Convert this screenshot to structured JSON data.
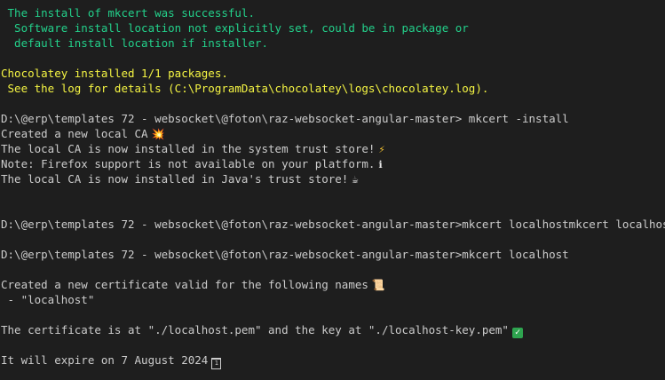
{
  "terminal": {
    "lines": [
      {
        "text": " The install of mkcert was successful.",
        "color": "#23d18b"
      },
      {
        "text": "  Software install location not explicitly set, could be in package or",
        "color": "#23d18b"
      },
      {
        "text": "  default install location if installer.",
        "color": "#23d18b"
      },
      {
        "text": "",
        "color": "#cccccc"
      },
      {
        "text": "Chocolatey installed 1/1 packages.",
        "color": "#f5f543"
      },
      {
        "text": " See the log for details (C:\\ProgramData\\chocolatey\\logs\\chocolatey.log).",
        "color": "#f5f543"
      },
      {
        "text": "",
        "color": "#cccccc"
      },
      {
        "text": "D:\\@erp\\templates 72 - websocket\\@foton\\raz-websocket-angular-master> mkcert -install",
        "color": "#cccccc"
      },
      {
        "text": "Created a new local CA",
        "color": "#cccccc",
        "icon": "collision-icon",
        "glyph": "💥"
      },
      {
        "text": "The local CA is now installed in the system trust store!",
        "color": "#cccccc",
        "icon": "lightning-icon",
        "glyph": "⚡"
      },
      {
        "text": "Note: Firefox support is not available on your platform.",
        "color": "#cccccc",
        "icon": "info-icon",
        "glyph": "ℹ"
      },
      {
        "text": "The local CA is now installed in Java's trust store!",
        "color": "#cccccc",
        "icon": "coffee-icon",
        "glyph": "☕"
      },
      {
        "text": "",
        "color": "#cccccc"
      },
      {
        "text": "",
        "color": "#cccccc"
      },
      {
        "text": "D:\\@erp\\templates 72 - websocket\\@foton\\raz-websocket-angular-master>mkcert localhostmkcert localhost",
        "color": "#cccccc"
      },
      {
        "text": "",
        "color": "#cccccc"
      },
      {
        "text": "D:\\@erp\\templates 72 - websocket\\@foton\\raz-websocket-angular-master>mkcert localhost",
        "color": "#cccccc"
      },
      {
        "text": "",
        "color": "#cccccc"
      },
      {
        "text": "Created a new certificate valid for the following names",
        "color": "#cccccc",
        "icon": "scroll-icon",
        "glyph": "📜"
      },
      {
        "text": " - \"localhost\"",
        "color": "#cccccc"
      },
      {
        "text": "",
        "color": "#cccccc"
      },
      {
        "text": "The certificate is at \"./localhost.pem\" and the key at \"./localhost-key.pem\"",
        "color": "#cccccc",
        "icon": "check-icon",
        "glyph": "✓"
      },
      {
        "text": "",
        "color": "#cccccc"
      },
      {
        "text": "It will expire on 7 August 2024",
        "color": "#cccccc",
        "icon": "calendar-icon",
        "glyph": "1"
      }
    ]
  }
}
